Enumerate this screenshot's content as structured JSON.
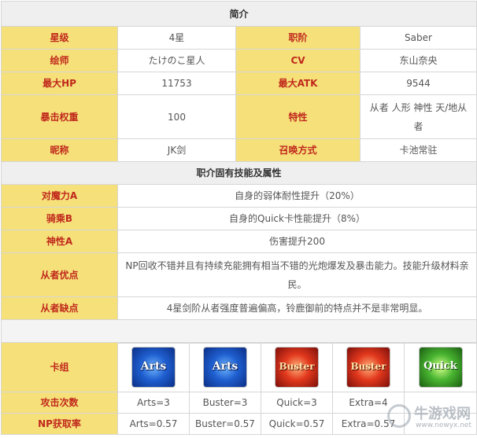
{
  "intro": {
    "title": "简介",
    "rows": [
      {
        "l1": "星级",
        "v1": "4星",
        "l2": "职阶",
        "v2": "Saber"
      },
      {
        "l1": "绘师",
        "v1": "たけのこ星人",
        "l2": "CV",
        "v2": "东山奈央"
      },
      {
        "l1": "最大HP",
        "v1": "11753",
        "l2": "最大ATK",
        "v2": "9544"
      },
      {
        "l1": "暴击权重",
        "v1": "100",
        "l2": "特性",
        "v2a": "从者 人形 神性 天/地从",
        "v2b": "者"
      },
      {
        "l1": "昵称",
        "v1": "JK剑",
        "l2": "召唤方式",
        "v2": "卡池常驻"
      }
    ]
  },
  "skills": {
    "title": "职介固有技能及属性",
    "rows": [
      {
        "label": "对魔力A",
        "desc": "自身的弱体耐性提升（20%）"
      },
      {
        "label": "骑乘B",
        "desc": "自身的Quick卡性能提升（8%）"
      },
      {
        "label": "神性A",
        "desc": "伤害提升200"
      }
    ],
    "strengths_label": "从者优点",
    "strengths_line1": "NP回收不错并且有持续充能拥有相当不错的光炮爆发及暴击能力。技能升级材料亲",
    "strengths_line2": "民。",
    "weakness_label": "从者缺点",
    "weakness_desc": "4星剑阶从者强度普遍偏高，铃鹿御前的特点并不是非常明显。"
  },
  "cards": {
    "label": "卡组",
    "items": [
      {
        "type": "arts",
        "text": "Arts",
        "icon": "arts-card-icon"
      },
      {
        "type": "arts",
        "text": "Arts",
        "icon": "arts-card-icon"
      },
      {
        "type": "buster",
        "text": "Buster",
        "icon": "buster-card-icon"
      },
      {
        "type": "buster",
        "text": "Buster",
        "icon": "buster-card-icon"
      },
      {
        "type": "quick",
        "text": "Quick",
        "icon": "quick-card-icon"
      }
    ]
  },
  "hits": {
    "label": "攻击次数",
    "values": [
      "Arts=3",
      "Buster=3",
      "Quick=3",
      "Extra=4"
    ]
  },
  "np": {
    "label": "NP获取率",
    "values": [
      "Arts=0.57",
      "Buster=0.57",
      "Quick=0.57",
      "Extra=0.57"
    ]
  },
  "watermark": {
    "name": "牛游戏网",
    "url": "www.newyx.net"
  },
  "colors": {
    "label_bg": "#f6e07a",
    "label_text": "#c0281c",
    "section_bg": "#efefef"
  }
}
